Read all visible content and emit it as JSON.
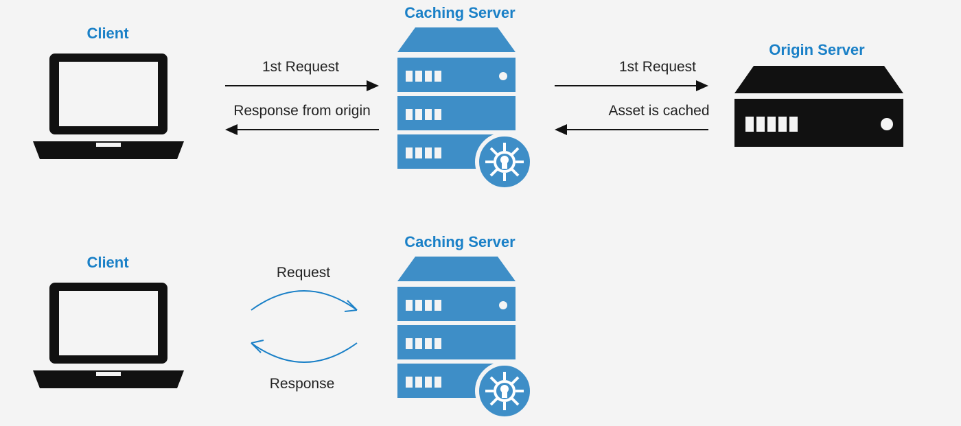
{
  "titles": {
    "client_top": "Client",
    "caching_top": "Caching Server",
    "origin": "Origin Server",
    "client_bottom": "Client",
    "caching_bottom": "Caching Server"
  },
  "labels": {
    "req1_left": "1st Request",
    "resp1_left": "Response from origin",
    "req1_right": "1st Request",
    "resp1_right": "Asset is cached",
    "req2": "Request",
    "resp2": "Response"
  },
  "colors": {
    "accent": "#1a80c7",
    "server": "#3e8ec7",
    "ink": "#111111"
  }
}
